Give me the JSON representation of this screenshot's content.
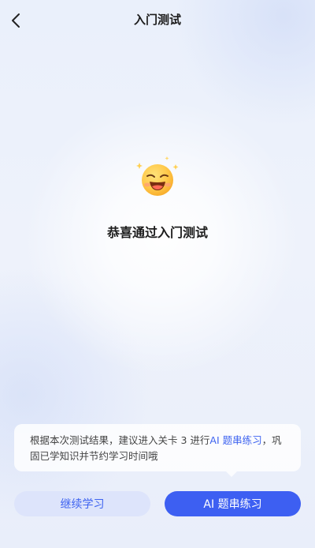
{
  "header": {
    "title": "入门测试"
  },
  "result": {
    "title": "恭喜通过入门测试"
  },
  "tip": {
    "text_before": "根据本次测试结果，建议进入关卡 3 进行",
    "link_text": "AI 题串练习",
    "text_after": "，巩固已学知识并节约学习时间哦"
  },
  "buttons": {
    "continue_label": "继续学习",
    "ai_label": "AI 题串练习"
  },
  "colors": {
    "accent": "#3d5ff2",
    "link": "#3e63f0",
    "secondary_button_bg": "#dde4fb",
    "background": "#e6edf9"
  }
}
